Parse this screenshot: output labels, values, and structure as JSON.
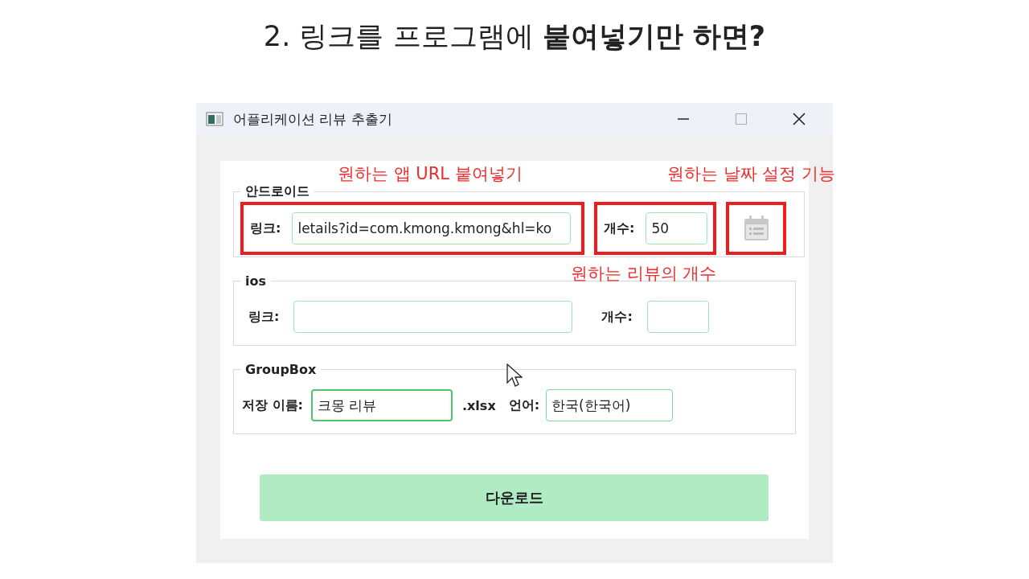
{
  "slide_title": "2. 링크를 프로그램에 **붙여넣기만 하면?**",
  "window": {
    "title": "어플리케이션 리뷰 추출기"
  },
  "android": {
    "legend": "안드로이드",
    "link": {
      "label": "링크:",
      "value": "letails?id=com.kmong.kmong&hl=ko",
      "highlighted": true
    },
    "count": {
      "label": "개수:",
      "value": "50",
      "highlighted": true
    },
    "date_button": {
      "highlighted": true
    }
  },
  "ios": {
    "legend": "ios",
    "link": {
      "label": "링크:"
    },
    "count": {
      "label": "개수:"
    }
  },
  "group_box": {
    "legend": "GroupBox",
    "save_label": "저장 이름:",
    "save_value": "크몽 리뷰",
    "extension": ".xlsx",
    "language_label": "언어:",
    "language_value": "한국(한국어)"
  },
  "download_button": "다운로드",
  "annotations": [
    {
      "text": "원하는 앱 URL 붙여넣기",
      "kind": "url"
    },
    {
      "text": "원하는 날짜 설정 기능",
      "kind": "date"
    },
    {
      "text": "원하는 리뷰의 개수",
      "kind": "count"
    }
  ]
}
